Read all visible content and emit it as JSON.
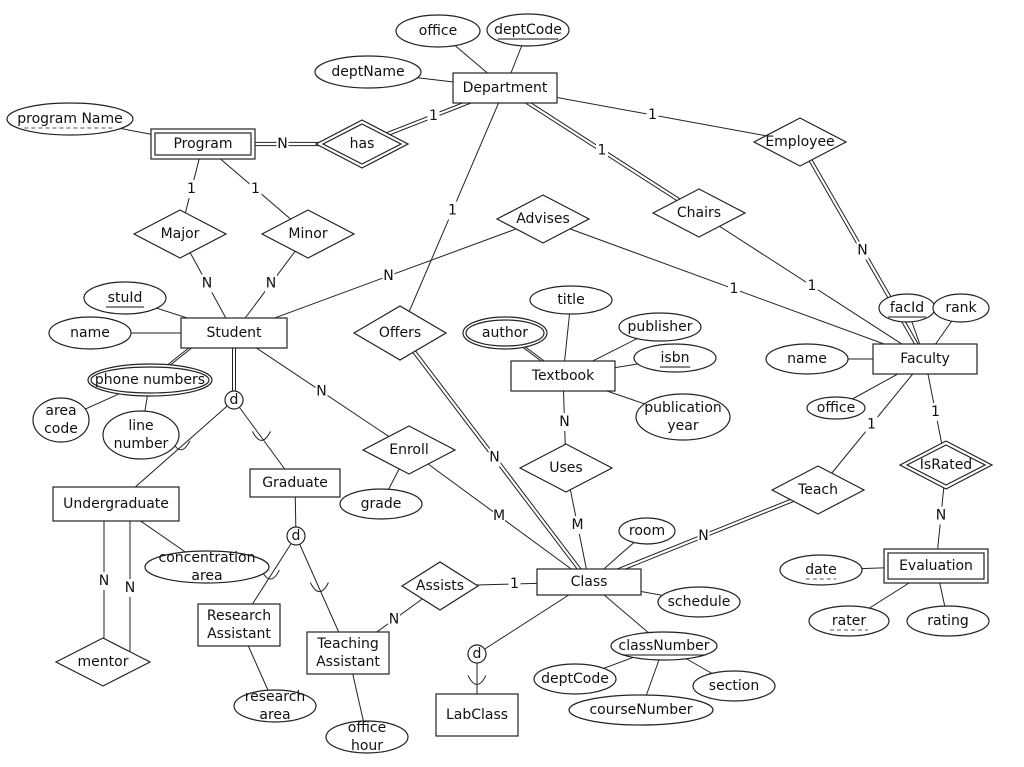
{
  "diagram": {
    "type": "er-diagram",
    "entities": [
      {
        "id": "department",
        "label": "Department",
        "weak": false
      },
      {
        "id": "program",
        "label": "Program",
        "weak": true
      },
      {
        "id": "student",
        "label": "Student",
        "weak": false
      },
      {
        "id": "faculty",
        "label": "Faculty",
        "weak": false
      },
      {
        "id": "textbook",
        "label": "Textbook",
        "weak": false
      },
      {
        "id": "class",
        "label": "Class",
        "weak": false
      },
      {
        "id": "undergraduate",
        "label": "Undergraduate",
        "weak": false
      },
      {
        "id": "graduate",
        "label": "Graduate",
        "weak": false
      },
      {
        "id": "research_assistant",
        "label": "Research\nAssistant",
        "weak": false
      },
      {
        "id": "teaching_assistant",
        "label": "Teaching\nAssistant",
        "weak": false
      },
      {
        "id": "labclass",
        "label": "LabClass",
        "weak": false
      },
      {
        "id": "evaluation",
        "label": "Evaluation",
        "weak": true
      }
    ],
    "relationships": [
      {
        "id": "has",
        "label": "has",
        "identifying": true
      },
      {
        "id": "employee",
        "label": "Employee",
        "identifying": false
      },
      {
        "id": "chairs",
        "label": "Chairs",
        "identifying": false
      },
      {
        "id": "major",
        "label": "Major",
        "identifying": false
      },
      {
        "id": "minor",
        "label": "Minor",
        "identifying": false
      },
      {
        "id": "advises",
        "label": "Advises",
        "identifying": false
      },
      {
        "id": "offers",
        "label": "Offers",
        "identifying": false
      },
      {
        "id": "enroll",
        "label": "Enroll",
        "identifying": false
      },
      {
        "id": "uses",
        "label": "Uses",
        "identifying": false
      },
      {
        "id": "teach",
        "label": "Teach",
        "identifying": false
      },
      {
        "id": "israted",
        "label": "IsRated",
        "identifying": true
      },
      {
        "id": "assists",
        "label": "Assists",
        "identifying": false
      },
      {
        "id": "mentor",
        "label": "mentor",
        "identifying": false
      }
    ],
    "attributes": [
      {
        "id": "dept_office",
        "label": "office",
        "owner": "department",
        "key": "none",
        "multivalued": false
      },
      {
        "id": "dept_code",
        "label": "deptCode",
        "owner": "department",
        "key": "primary",
        "multivalued": false
      },
      {
        "id": "dept_name",
        "label": "deptName",
        "owner": "department",
        "key": "none",
        "multivalued": false
      },
      {
        "id": "program_name",
        "label": "program Name",
        "owner": "program",
        "key": "partial",
        "multivalued": false
      },
      {
        "id": "stu_id",
        "label": "stuId",
        "owner": "student",
        "key": "primary",
        "multivalued": false
      },
      {
        "id": "stu_name",
        "label": "name",
        "owner": "student",
        "key": "none",
        "multivalued": false
      },
      {
        "id": "phone_numbers",
        "label": "phone numbers",
        "owner": "student",
        "key": "none",
        "multivalued": true
      },
      {
        "id": "area_code",
        "label": "area\ncode",
        "owner": "phone_numbers",
        "key": "none",
        "multivalued": false
      },
      {
        "id": "line_number",
        "label": "line\nnumber",
        "owner": "phone_numbers",
        "key": "none",
        "multivalued": false
      },
      {
        "id": "title",
        "label": "title",
        "owner": "textbook",
        "key": "none",
        "multivalued": false
      },
      {
        "id": "author",
        "label": "author",
        "owner": "textbook",
        "key": "none",
        "multivalued": true
      },
      {
        "id": "publisher",
        "label": "publisher",
        "owner": "textbook",
        "key": "none",
        "multivalued": false
      },
      {
        "id": "isbn",
        "label": "isbn",
        "owner": "textbook",
        "key": "primary",
        "multivalued": false
      },
      {
        "id": "pub_year",
        "label": "publication\nyear",
        "owner": "textbook",
        "key": "none",
        "multivalued": false
      },
      {
        "id": "fac_id",
        "label": "facId",
        "owner": "faculty",
        "key": "primary",
        "multivalued": false
      },
      {
        "id": "rank",
        "label": "rank",
        "owner": "faculty",
        "key": "none",
        "multivalued": false
      },
      {
        "id": "fac_name",
        "label": "name",
        "owner": "faculty",
        "key": "none",
        "multivalued": false
      },
      {
        "id": "fac_office",
        "label": "office",
        "owner": "faculty",
        "key": "none",
        "multivalued": false
      },
      {
        "id": "date",
        "label": "date",
        "owner": "evaluation",
        "key": "partial",
        "multivalued": false
      },
      {
        "id": "rater",
        "label": "rater",
        "owner": "evaluation",
        "key": "partial",
        "multivalued": false
      },
      {
        "id": "rating",
        "label": "rating",
        "owner": "evaluation",
        "key": "none",
        "multivalued": false
      },
      {
        "id": "grade",
        "label": "grade",
        "owner": "enroll",
        "key": "none",
        "multivalued": false
      },
      {
        "id": "concentration_area",
        "label": "concentration\narea",
        "owner": "undergraduate",
        "key": "none",
        "multivalued": false
      },
      {
        "id": "research_area",
        "label": "research\narea",
        "owner": "research_assistant",
        "key": "none",
        "multivalued": false
      },
      {
        "id": "office_hour",
        "label": "office\nhour",
        "owner": "teaching_assistant",
        "key": "none",
        "multivalued": false
      },
      {
        "id": "room",
        "label": "room",
        "owner": "class",
        "key": "none",
        "multivalued": false
      },
      {
        "id": "schedule",
        "label": "schedule",
        "owner": "class",
        "key": "none",
        "multivalued": false
      },
      {
        "id": "class_number",
        "label": "classNumber",
        "owner": "class",
        "key": "primary",
        "multivalued": false
      },
      {
        "id": "cn_dept_code",
        "label": "deptCode",
        "owner": "class_number",
        "key": "none",
        "multivalued": false
      },
      {
        "id": "course_number",
        "label": "courseNumber",
        "owner": "class_number",
        "key": "none",
        "multivalued": false
      },
      {
        "id": "section",
        "label": "section",
        "owner": "class_number",
        "key": "none",
        "multivalued": false
      }
    ],
    "connections": [
      {
        "from": "program",
        "to": "has",
        "cardinality": "N",
        "total": true
      },
      {
        "from": "has",
        "to": "department",
        "cardinality": "1",
        "total": true
      },
      {
        "from": "department",
        "to": "employee",
        "cardinality": "1",
        "total": false
      },
      {
        "from": "employee",
        "to": "faculty",
        "cardinality": "N",
        "total": true
      },
      {
        "from": "department",
        "to": "chairs",
        "cardinality": "1",
        "total": true
      },
      {
        "from": "chairs",
        "to": "faculty",
        "cardinality": "1",
        "total": false
      },
      {
        "from": "program",
        "to": "major",
        "cardinality": "1",
        "total": false
      },
      {
        "from": "major",
        "to": "student",
        "cardinality": "N",
        "total": false
      },
      {
        "from": "program",
        "to": "minor",
        "cardinality": "1",
        "total": false
      },
      {
        "from": "minor",
        "to": "student",
        "cardinality": "N",
        "total": false
      },
      {
        "from": "student",
        "to": "advises",
        "cardinality": "N",
        "total": false
      },
      {
        "from": "advises",
        "to": "faculty",
        "cardinality": "1",
        "total": false
      },
      {
        "from": "department",
        "to": "offers",
        "cardinality": "1",
        "total": false
      },
      {
        "from": "offers",
        "to": "class",
        "cardinality": "N",
        "total": true
      },
      {
        "from": "student",
        "to": "enroll",
        "cardinality": "N",
        "total": false
      },
      {
        "from": "enroll",
        "to": "class",
        "cardinality": "M",
        "total": false
      },
      {
        "from": "textbook",
        "to": "uses",
        "cardinality": "N",
        "total": false
      },
      {
        "from": "uses",
        "to": "class",
        "cardinality": "M",
        "total": false
      },
      {
        "from": "class",
        "to": "teach",
        "cardinality": "N",
        "total": true
      },
      {
        "from": "teach",
        "to": "faculty",
        "cardinality": "1",
        "total": false
      },
      {
        "from": "faculty",
        "to": "israted",
        "cardinality": "1",
        "total": false
      },
      {
        "from": "israted",
        "to": "evaluation",
        "cardinality": "N",
        "total": false
      },
      {
        "from": "assists",
        "to": "class",
        "cardinality": "1",
        "total": false
      },
      {
        "from": "teaching_assistant",
        "to": "assists",
        "cardinality": "N",
        "total": false
      },
      {
        "from": "undergraduate",
        "to": "mentor",
        "cardinality": "N",
        "total": false
      },
      {
        "from": "undergraduate",
        "to": "mentor",
        "cardinality": "N",
        "total": false
      }
    ],
    "specializations": [
      {
        "parent": "student",
        "symbol": "d",
        "children": [
          "undergraduate",
          "graduate"
        ],
        "total": true
      },
      {
        "parent": "graduate",
        "symbol": "d",
        "children": [
          "research_assistant",
          "teaching_assistant"
        ],
        "total": false
      },
      {
        "parent": "class",
        "symbol": "d",
        "children": [
          "labclass"
        ],
        "total": false
      }
    ]
  }
}
